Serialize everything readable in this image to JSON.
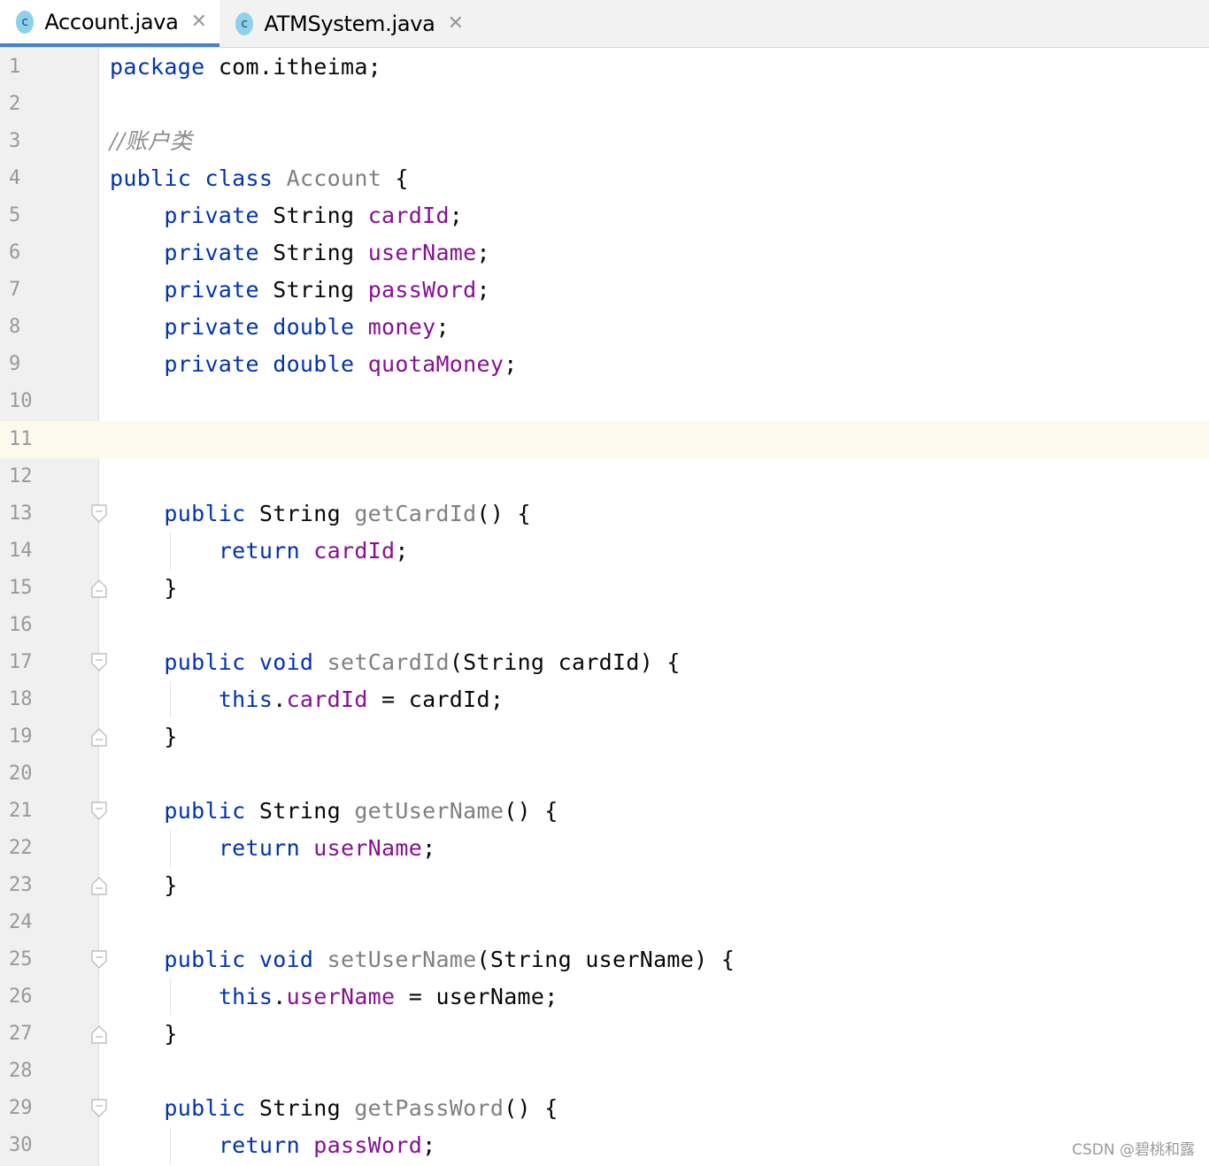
{
  "tabs": [
    {
      "icon": "c",
      "label": "Account.java",
      "active": true
    },
    {
      "icon": "c",
      "label": "ATMSystem.java",
      "active": false
    }
  ],
  "current_line": 11,
  "lines": [
    {
      "n": "1",
      "tokens": [
        [
          "kw",
          "package"
        ],
        [
          "plain",
          " com.itheima;"
        ]
      ]
    },
    {
      "n": "2",
      "tokens": []
    },
    {
      "n": "3",
      "tokens": [
        [
          "cmt",
          "//账户类"
        ]
      ]
    },
    {
      "n": "4",
      "tokens": [
        [
          "kw",
          "public"
        ],
        [
          "plain",
          " "
        ],
        [
          "kw",
          "class"
        ],
        [
          "plain",
          " "
        ],
        [
          "cls",
          "Account"
        ],
        [
          "plain",
          " {"
        ]
      ]
    },
    {
      "n": "5",
      "tokens": [
        [
          "plain",
          "    "
        ],
        [
          "kw",
          "private"
        ],
        [
          "plain",
          " String "
        ],
        [
          "fld",
          "cardId"
        ],
        [
          "plain",
          ";"
        ]
      ]
    },
    {
      "n": "6",
      "tokens": [
        [
          "plain",
          "    "
        ],
        [
          "kw",
          "private"
        ],
        [
          "plain",
          " String "
        ],
        [
          "fld",
          "userName"
        ],
        [
          "plain",
          ";"
        ]
      ]
    },
    {
      "n": "7",
      "tokens": [
        [
          "plain",
          "    "
        ],
        [
          "kw",
          "private"
        ],
        [
          "plain",
          " String "
        ],
        [
          "fld",
          "passWord"
        ],
        [
          "plain",
          ";"
        ]
      ]
    },
    {
      "n": "8",
      "tokens": [
        [
          "plain",
          "    "
        ],
        [
          "kw",
          "private"
        ],
        [
          "plain",
          " "
        ],
        [
          "kw",
          "double"
        ],
        [
          "plain",
          " "
        ],
        [
          "fld",
          "money"
        ],
        [
          "plain",
          ";"
        ]
      ]
    },
    {
      "n": "9",
      "tokens": [
        [
          "plain",
          "    "
        ],
        [
          "kw",
          "private"
        ],
        [
          "plain",
          " "
        ],
        [
          "kw",
          "double"
        ],
        [
          "plain",
          " "
        ],
        [
          "fld",
          "quotaMoney"
        ],
        [
          "plain",
          ";"
        ]
      ]
    },
    {
      "n": "10",
      "tokens": []
    },
    {
      "n": "11",
      "tokens": []
    },
    {
      "n": "12",
      "tokens": []
    },
    {
      "n": "13",
      "fold": "open",
      "tokens": [
        [
          "plain",
          "    "
        ],
        [
          "kw",
          "public"
        ],
        [
          "plain",
          " String "
        ],
        [
          "mth",
          "getCardId"
        ],
        [
          "plain",
          "() {"
        ]
      ]
    },
    {
      "n": "14",
      "tokens": [
        [
          "plain",
          "        "
        ],
        [
          "kw",
          "return"
        ],
        [
          "plain",
          " "
        ],
        [
          "fld",
          "cardId"
        ],
        [
          "plain",
          ";"
        ]
      ]
    },
    {
      "n": "15",
      "fold": "close",
      "tokens": [
        [
          "plain",
          "    }"
        ]
      ]
    },
    {
      "n": "16",
      "tokens": []
    },
    {
      "n": "17",
      "fold": "open",
      "tokens": [
        [
          "plain",
          "    "
        ],
        [
          "kw",
          "public"
        ],
        [
          "plain",
          " "
        ],
        [
          "kw",
          "void"
        ],
        [
          "plain",
          " "
        ],
        [
          "mth",
          "setCardId"
        ],
        [
          "plain",
          "(String cardId) {"
        ]
      ]
    },
    {
      "n": "18",
      "tokens": [
        [
          "plain",
          "        "
        ],
        [
          "kw",
          "this"
        ],
        [
          "plain",
          "."
        ],
        [
          "fld",
          "cardId"
        ],
        [
          "plain",
          " = cardId;"
        ]
      ]
    },
    {
      "n": "19",
      "fold": "close",
      "tokens": [
        [
          "plain",
          "    }"
        ]
      ]
    },
    {
      "n": "20",
      "tokens": []
    },
    {
      "n": "21",
      "fold": "open",
      "tokens": [
        [
          "plain",
          "    "
        ],
        [
          "kw",
          "public"
        ],
        [
          "plain",
          " String "
        ],
        [
          "mth",
          "getUserName"
        ],
        [
          "plain",
          "() {"
        ]
      ]
    },
    {
      "n": "22",
      "tokens": [
        [
          "plain",
          "        "
        ],
        [
          "kw",
          "return"
        ],
        [
          "plain",
          " "
        ],
        [
          "fld",
          "userName"
        ],
        [
          "plain",
          ";"
        ]
      ]
    },
    {
      "n": "23",
      "fold": "close",
      "tokens": [
        [
          "plain",
          "    }"
        ]
      ]
    },
    {
      "n": "24",
      "tokens": []
    },
    {
      "n": "25",
      "fold": "open",
      "tokens": [
        [
          "plain",
          "    "
        ],
        [
          "kw",
          "public"
        ],
        [
          "plain",
          " "
        ],
        [
          "kw",
          "void"
        ],
        [
          "plain",
          " "
        ],
        [
          "mth",
          "setUserName"
        ],
        [
          "plain",
          "(String userName) {"
        ]
      ]
    },
    {
      "n": "26",
      "tokens": [
        [
          "plain",
          "        "
        ],
        [
          "kw",
          "this"
        ],
        [
          "plain",
          "."
        ],
        [
          "fld",
          "userName"
        ],
        [
          "plain",
          " = userName;"
        ]
      ]
    },
    {
      "n": "27",
      "fold": "close",
      "tokens": [
        [
          "plain",
          "    }"
        ]
      ]
    },
    {
      "n": "28",
      "tokens": []
    },
    {
      "n": "29",
      "fold": "open",
      "tokens": [
        [
          "plain",
          "    "
        ],
        [
          "kw",
          "public"
        ],
        [
          "plain",
          " String "
        ],
        [
          "mth",
          "getPassWord"
        ],
        [
          "plain",
          "() {"
        ]
      ]
    },
    {
      "n": "30",
      "tokens": [
        [
          "plain",
          "        "
        ],
        [
          "kw",
          "return"
        ],
        [
          "plain",
          " "
        ],
        [
          "fld",
          "passWord"
        ],
        [
          "plain",
          ";"
        ]
      ]
    }
  ],
  "watermark": "CSDN @碧桃和露"
}
